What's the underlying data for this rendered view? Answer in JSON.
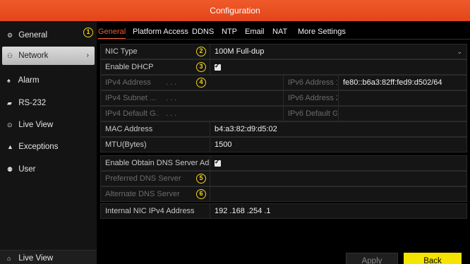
{
  "window": {
    "title": "Configuration"
  },
  "sidebar": {
    "items": [
      {
        "label": "General",
        "icon": "gear-icon",
        "glyph": "⚙"
      },
      {
        "label": "Network",
        "icon": "network-icon",
        "glyph": "⚇",
        "chevron": "›"
      },
      {
        "label": "Alarm",
        "icon": "alarm-icon",
        "glyph": "♠"
      },
      {
        "label": "RS-232",
        "icon": "serial-port-icon",
        "glyph": "▰"
      },
      {
        "label": "Live View",
        "icon": "eye-icon",
        "glyph": "⊙"
      },
      {
        "label": "Exceptions",
        "icon": "warning-icon",
        "glyph": "▲"
      },
      {
        "label": "User",
        "icon": "user-icon",
        "glyph": "⚉"
      }
    ],
    "bottom": {
      "label": "Live View",
      "icon": "home-icon",
      "glyph": "⌂"
    }
  },
  "badges": [
    "1",
    "2",
    "3",
    "4",
    "5",
    "6"
  ],
  "tabs": [
    "General",
    "Platform Access",
    "DDNS",
    "NTP",
    "Email",
    "NAT",
    "More Settings"
  ],
  "form": {
    "nic_type": {
      "label": "NIC Type",
      "value": "100M Full-dup",
      "arrow": "⌄"
    },
    "enable_dhcp": {
      "label": "Enable DHCP",
      "checked": true
    },
    "ipv4_address": {
      "label": "IPv4 Address",
      "value": ". . ."
    },
    "ipv4_subnet": {
      "label": "IPv4 Subnet ...",
      "value": ". . ."
    },
    "ipv4_gateway": {
      "label": "IPv4 Default G...",
      "value": ". . ."
    },
    "ipv6_address1": {
      "label": "IPv6 Address 1",
      "value": "fe80::b6a3:82ff:fed9:d502/64"
    },
    "ipv6_address2": {
      "label": "IPv6 Address 2",
      "value": ""
    },
    "ipv6_gateway": {
      "label": "IPv6 Default G...",
      "value": ""
    },
    "mac_address": {
      "label": "MAC Address",
      "value": "b4:a3:82:d9:d5:02"
    },
    "mtu": {
      "label": "MTU(Bytes)",
      "value": "1500"
    },
    "obtain_dns": {
      "label": "Enable Obtain DNS Server Addr...",
      "checked": true
    },
    "preferred_dns": {
      "label": "Preferred DNS Server",
      "value": ""
    },
    "alternate_dns": {
      "label": "Alternate DNS Server",
      "value": ""
    },
    "internal_nic": {
      "label": "Internal NIC IPv4 Address",
      "value": "192 .168 .254 .1"
    }
  },
  "buttons": {
    "apply": "Apply",
    "back": "Back"
  },
  "colors": {
    "accent": "#f05a2a",
    "back_button": "#f5e400",
    "badge": "#f2d31a"
  }
}
